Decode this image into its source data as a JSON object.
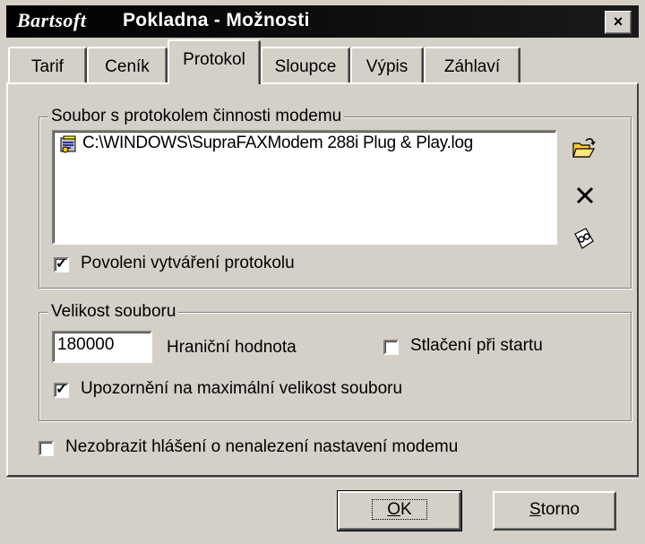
{
  "window": {
    "brand": "Bartsoft",
    "title": "Pokladna - Možnosti",
    "close_label": "×"
  },
  "tabs": [
    {
      "label": "Tarif",
      "active": false
    },
    {
      "label": "Ceník",
      "active": false
    },
    {
      "label": "Protokol",
      "active": true
    },
    {
      "label": "Sloupce",
      "active": false
    },
    {
      "label": "Výpis",
      "active": false
    },
    {
      "label": "Záhlaví",
      "active": false
    }
  ],
  "log_group": {
    "legend": "Soubor s protokolem činnosti modemu",
    "file_path": "C:\\WINDOWS\\SupraFAXModem 288i Plug & Play.log",
    "enable_checkbox_label": "Povoleni vytváření protokolu",
    "enable_checked": true,
    "icons": [
      "open-folder-icon",
      "delete-icon",
      "view-log-icon"
    ]
  },
  "size_group": {
    "legend": "Velikost souboru",
    "limit_value": "180000",
    "limit_label": "Hraniční hodnota",
    "compress_label": "Stlačení při startu",
    "compress_checked": false,
    "warn_label": "Upozornění na maximální velikost souboru",
    "warn_checked": true
  },
  "hide_modem_label": "Nezobrazit hlášení o nenalezení nastavení modemu",
  "hide_modem_checked": false,
  "buttons": {
    "ok_accel": "O",
    "ok_rest": "K",
    "cancel_accel": "S",
    "cancel_rest": "torno"
  },
  "colors": {
    "face": "#d4d0c8",
    "titlebar": "#000000"
  }
}
